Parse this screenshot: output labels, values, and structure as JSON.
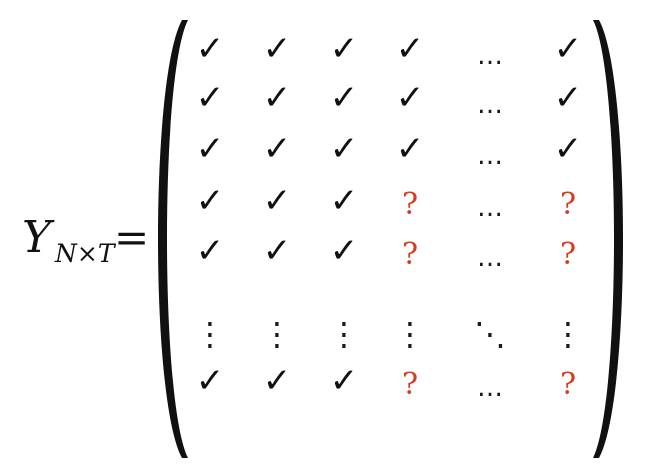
{
  "equation": {
    "lhs": {
      "symbol": "Y",
      "subscript": "N×T",
      "equals": "="
    },
    "matrix": {
      "rows": [
        [
          "✓",
          "✓",
          "✓",
          "✓",
          "…",
          "✓"
        ],
        [
          "✓",
          "✓",
          "✓",
          "✓",
          "…",
          "✓"
        ],
        [
          "✓",
          "✓",
          "✓",
          "✓",
          "…",
          "✓"
        ],
        [
          "✓",
          "✓",
          "✓",
          "?",
          "…",
          "?"
        ],
        [
          "✓",
          "✓",
          "✓",
          "?",
          "…",
          "?"
        ],
        [
          "⋮",
          "⋮",
          "⋮",
          "⋮",
          "⋱",
          "⋮"
        ],
        [
          "✓",
          "✓",
          "✓",
          "?",
          "…",
          "?"
        ]
      ]
    },
    "colors": {
      "observed": "#111111",
      "missing": "#d63a1f",
      "ellipsis": "#1a1a1a"
    }
  }
}
